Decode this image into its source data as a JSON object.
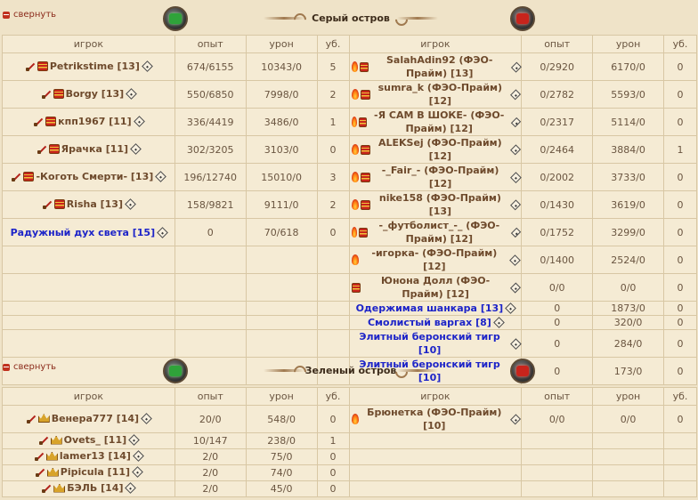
{
  "collapse_label": "свернуть",
  "colors": {
    "player_name": "#6e4a2c",
    "bot_name": "#1d24c8",
    "header_text": "#6a5540"
  },
  "icons": [
    "sword-icon",
    "fire-icon",
    "rank-icon",
    "crown-icon",
    "info-icon",
    "collapse-icon",
    "team-emblem-green",
    "team-emblem-red"
  ],
  "sections": [
    {
      "title": "Серый остров",
      "headers": {
        "player": "игрок",
        "exp": "опыт",
        "damage": "урон",
        "kills": "уб."
      },
      "left": [
        {
          "name": "Petrikstime [13]",
          "exp": "674/6155",
          "dmg": "10343/0",
          "kills": "5"
        },
        {
          "name": "Borgy [13]",
          "exp": "550/6850",
          "dmg": "7998/0",
          "kills": "2"
        },
        {
          "name": "кпп1967 [11]",
          "exp": "336/4419",
          "dmg": "3486/0",
          "kills": "1"
        },
        {
          "name": "Ярачка [11]",
          "exp": "302/3205",
          "dmg": "3103/0",
          "kills": "0"
        },
        {
          "name": "-Коготь Смерти- [13]",
          "exp": "196/12740",
          "dmg": "15010/0",
          "kills": "3"
        },
        {
          "name": "Risha [13]",
          "exp": "158/9821",
          "dmg": "9111/0",
          "kills": "2"
        },
        {
          "name": "Радужный дух света  [15]",
          "exp": "0",
          "dmg": "70/618",
          "kills": "0"
        }
      ],
      "right": [
        {
          "name": "SalahAdin92 (ФЭО-Прайм) [13]",
          "exp": "0/2920",
          "dmg": "6170/0",
          "kills": "0"
        },
        {
          "name": "sumra_k (ФЭО-Прайм) [12]",
          "exp": "0/2782",
          "dmg": "5593/0",
          "kills": "0"
        },
        {
          "name": "-Я САМ В ШОКЕ- (ФЭО-Прайм) [12]",
          "exp": "0/2317",
          "dmg": "5114/0",
          "kills": "0"
        },
        {
          "name": "ALEKSej (ФЭО-Прайм) [12]",
          "exp": "0/2464",
          "dmg": "3884/0",
          "kills": "1"
        },
        {
          "name": "-_Fair_- (ФЭО-Прайм) [12]",
          "exp": "0/2002",
          "dmg": "3733/0",
          "kills": "0"
        },
        {
          "name": "nike158 (ФЭО-Прайм) [13]",
          "exp": "0/1430",
          "dmg": "3619/0",
          "kills": "0"
        },
        {
          "name": "-_футболист_-_ (ФЭО-Прайм) [12]",
          "exp": "0/1752",
          "dmg": "3299/0",
          "kills": "0"
        },
        {
          "name": "-игорка- (ФЭО-Прайм) [12]",
          "exp": "0/1400",
          "dmg": "2524/0",
          "kills": "0"
        },
        {
          "name": "Юнона Долл (ФЭО-Прайм) [12]",
          "exp": "0/0",
          "dmg": "0/0",
          "kills": "0"
        },
        {
          "name": "Одержимая шанкара [13]",
          "exp": "0",
          "dmg": "1873/0",
          "kills": "0"
        },
        {
          "name": "Смолистый варгах  [8]",
          "exp": "0",
          "dmg": "320/0",
          "kills": "0"
        },
        {
          "name": "Элитный беронский тигр [10]",
          "exp": "0",
          "dmg": "284/0",
          "kills": "0"
        },
        {
          "name": "Элитный беронский тигр [10]",
          "exp": "0",
          "dmg": "173/0",
          "kills": "0"
        }
      ]
    },
    {
      "title": "Зеленый остров",
      "headers": {
        "player": "игрок",
        "exp": "опыт",
        "damage": "урон",
        "kills": "уб."
      },
      "left": [
        {
          "name": "Венера777 [14]",
          "exp": "20/0",
          "dmg": "548/0",
          "kills": "0"
        },
        {
          "name": "Ovets_ [11]",
          "exp": "10/147",
          "dmg": "238/0",
          "kills": "1"
        },
        {
          "name": "lamer13 [14]",
          "exp": "2/0",
          "dmg": "75/0",
          "kills": "0"
        },
        {
          "name": "Pipicula [11]",
          "exp": "2/0",
          "dmg": "74/0",
          "kills": "0"
        },
        {
          "name": "БЭЛЬ [14]",
          "exp": "2/0",
          "dmg": "45/0",
          "kills": "0"
        }
      ],
      "right": [
        {
          "name": "Брюнетка (ФЭО-Прайм) [10]",
          "exp": "0/0",
          "dmg": "0/0",
          "kills": "0"
        }
      ]
    }
  ]
}
